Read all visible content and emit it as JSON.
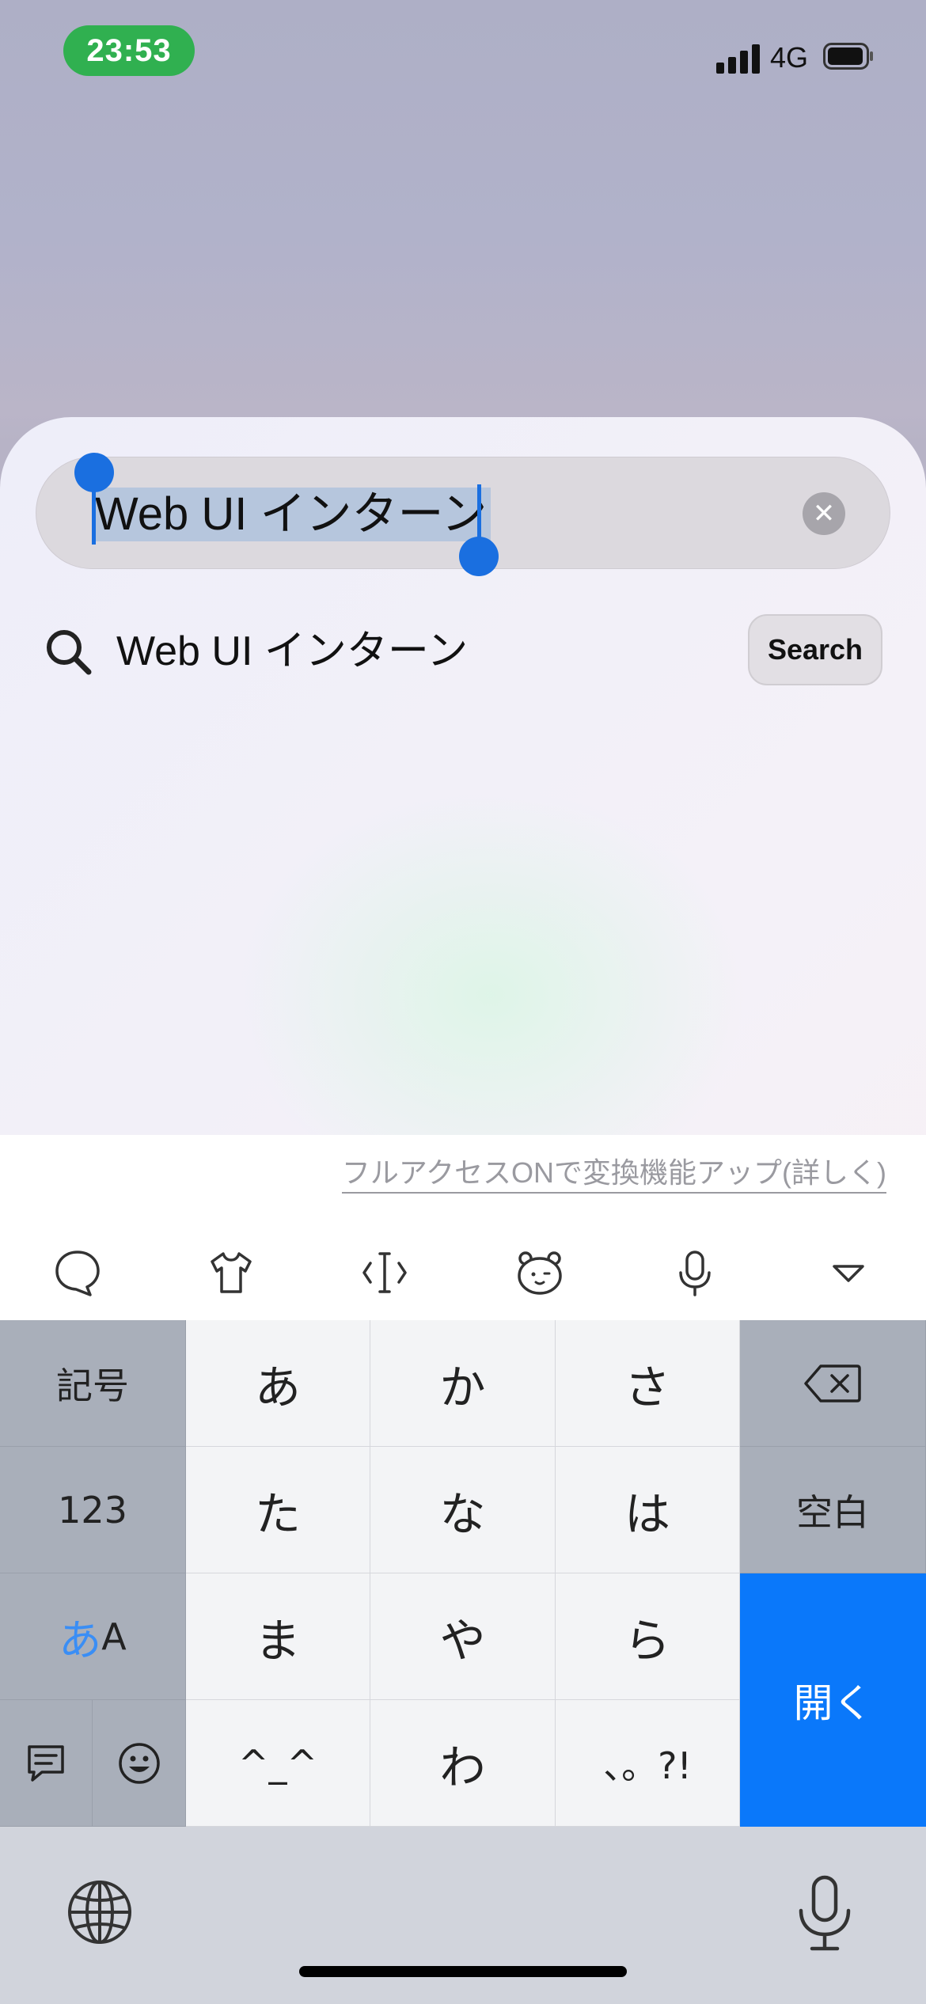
{
  "status_bar": {
    "time": "23:53",
    "network": "4G",
    "signal_icon": "cellular-signal-icon",
    "battery_icon": "battery-icon"
  },
  "search": {
    "query": "Web UI インターン",
    "clear_icon": "clear-icon",
    "suggestion_text": "Web UI インターン",
    "suggestion_icon": "search-icon",
    "search_button_label": "Search"
  },
  "keyboard": {
    "notice": "フルアクセスONで変換機能アップ(詳しく)",
    "toolbar_icons": [
      "chat-bubble-icon",
      "tshirt-icon",
      "cursor-move-icon",
      "bear-face-icon",
      "microphone-icon",
      "collapse-keyboard-icon"
    ],
    "keys": {
      "symbols": "記号",
      "a": "あ",
      "ka": "か",
      "sa": "さ",
      "numbers": "123",
      "ta": "た",
      "na": "な",
      "ha": "は",
      "space": "空白",
      "mode_kana": "あ",
      "mode_latin": "A",
      "ma": "ま",
      "ya": "や",
      "ra": "ら",
      "enter": "開く",
      "kaomoji": "^_^",
      "wa": "わ",
      "punctuation": "、。?!"
    },
    "bottom_icons": [
      "globe-icon",
      "dictation-icon"
    ]
  },
  "colors": {
    "accent": "#0a78fa",
    "selection": "#1a6fe0",
    "time_pill": "#30b050"
  }
}
